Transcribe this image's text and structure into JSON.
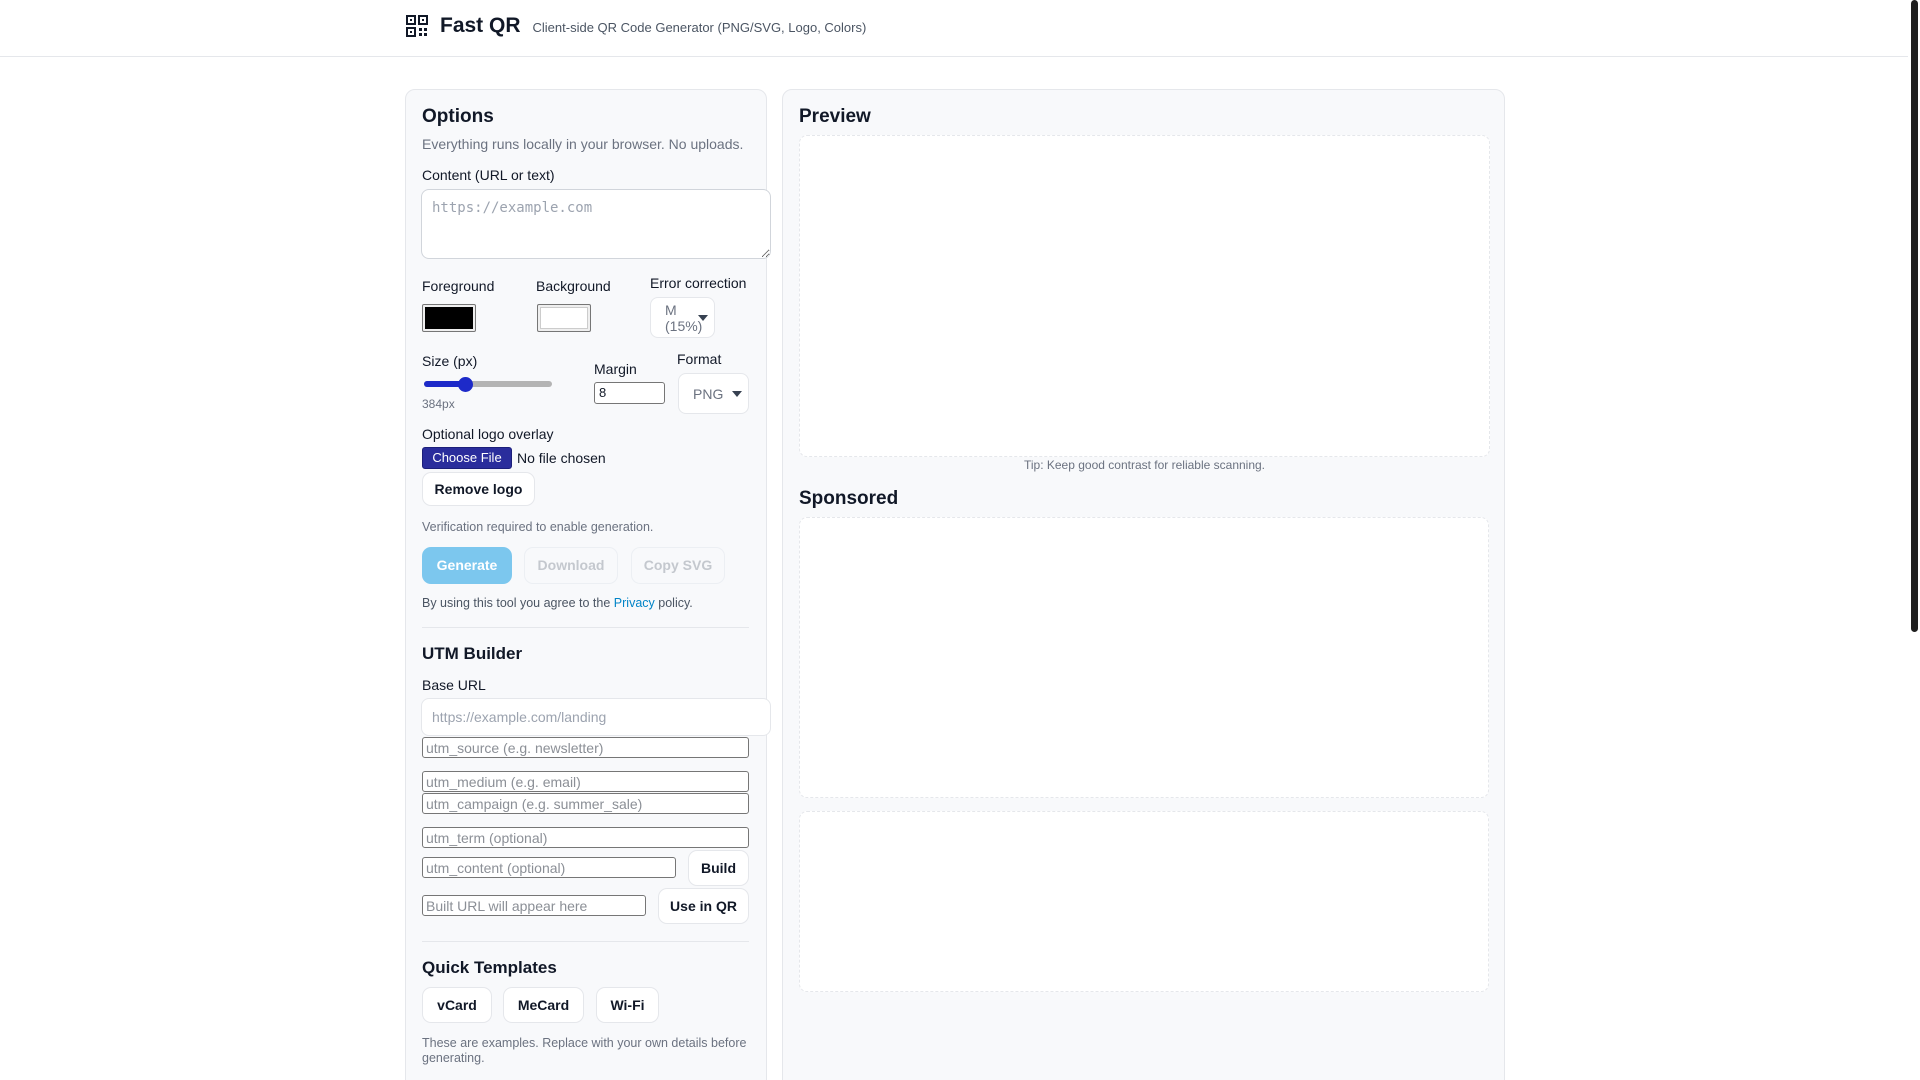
{
  "header": {
    "brand_name": "Fast QR",
    "tagline": "Client-side QR Code Generator (PNG/SVG, Logo, Colors)"
  },
  "options": {
    "title": "Options",
    "subtitle": "Everything runs locally in your browser. No uploads.",
    "content_label": "Content (URL or text)",
    "content_placeholder": "https://example.com",
    "content_value": "",
    "foreground_label": "Foreground",
    "foreground_color": "#000000",
    "background_label": "Background",
    "background_color": "#ffffff",
    "error_correction_label": "Error correction",
    "error_correction_value": "M (15%)",
    "size_label": "Size (px)",
    "size_value": "384px",
    "size_fraction": 0.3,
    "margin_label": "Margin",
    "margin_value": "8",
    "format_label": "Format",
    "format_value": "PNG",
    "logo_label": "Optional logo overlay",
    "choose_file_label": "Choose File",
    "no_file_text": "No file chosen",
    "remove_logo_label": "Remove logo",
    "verification_text": "Verification required to enable generation.",
    "generate_label": "Generate",
    "download_label": "Download",
    "copy_svg_label": "Copy SVG",
    "terms_prefix": "By using this tool you agree to the",
    "privacy_link": "Privacy",
    "terms_suffix": "policy."
  },
  "utm": {
    "title": "UTM Builder",
    "base_url_label": "Base URL",
    "base_url_placeholder": "https://example.com/landing",
    "source_placeholder": "utm_source (e.g. newsletter)",
    "medium_placeholder": "utm_medium (e.g. email)",
    "campaign_placeholder": "utm_campaign (e.g. summer_sale)",
    "term_placeholder": "utm_term (optional)",
    "content_placeholder": "utm_content (optional)",
    "build_label": "Build",
    "built_placeholder": "Built URL will appear here",
    "use_in_qr_label": "Use in QR"
  },
  "templates": {
    "title": "Quick Templates",
    "vcard_label": "vCard",
    "mecard_label": "MeCard",
    "wifi_label": "Wi-Fi",
    "note": "These are examples. Replace with your own details before generating."
  },
  "preview": {
    "title": "Preview",
    "tip": "Tip: Keep good contrast for reliable scanning."
  },
  "sponsored": {
    "title": "Sponsored"
  },
  "colors": {
    "accent": "#1d2ac9",
    "primary_button": "#7cc7ee",
    "link": "#0284c7"
  }
}
